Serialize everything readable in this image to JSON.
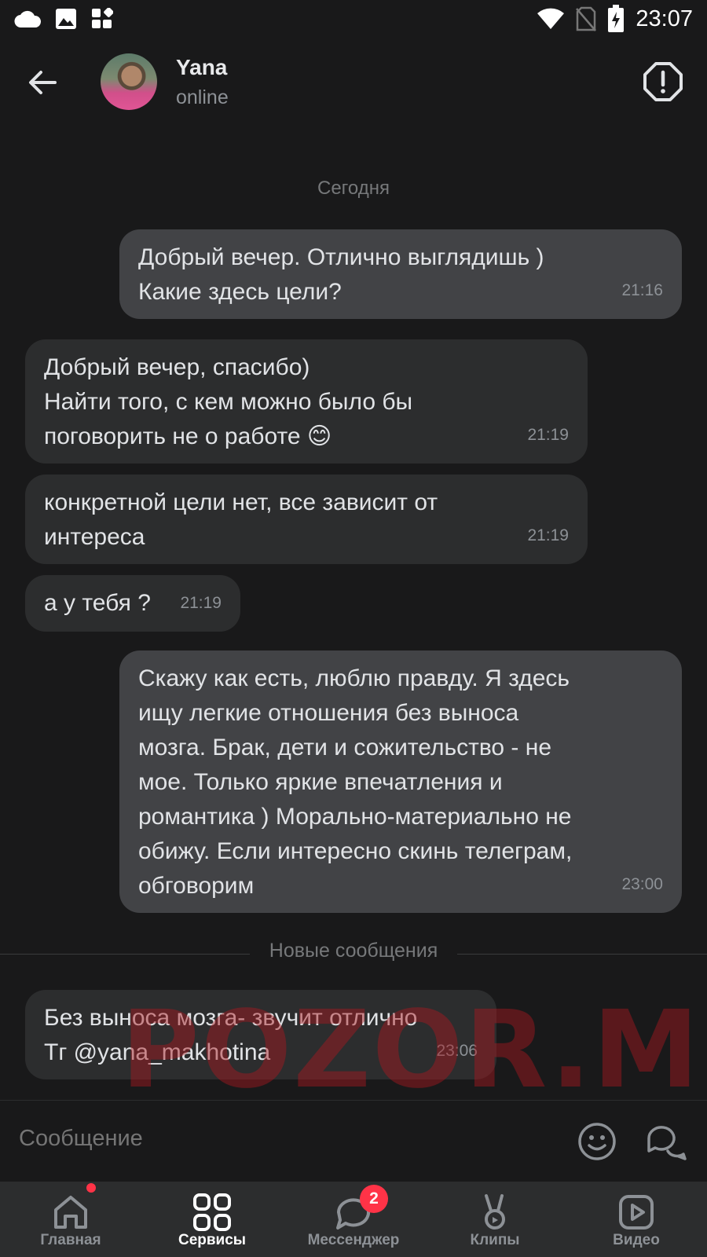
{
  "status_bar": {
    "time": "23:07",
    "left_icons": [
      "cloud-icon",
      "image-icon",
      "widgets-icon"
    ],
    "right_icons": [
      "wifi-icon",
      "no-sim-icon",
      "battery-charging-icon"
    ]
  },
  "header": {
    "contact_name": "Yana",
    "contact_status": "online",
    "back_icon": "arrow-left-icon",
    "report_icon": "alert-octagon-icon"
  },
  "chat": {
    "date_separator": "Сегодня",
    "new_messages_separator": "Новые сообщения",
    "messages": [
      {
        "direction": "out",
        "text": "Добрый вечер. Отлично выглядишь )\nКакие здесь цели?",
        "time": "21:16"
      },
      {
        "direction": "in",
        "text": "Добрый вечер, спасибо)\nНайти того, с кем можно было бы\nпоговорить не о работе 😊",
        "time": "21:19"
      },
      {
        "direction": "in",
        "text": "конкретной цели нет, все зависит от\nинтереса",
        "time": "21:19"
      },
      {
        "direction": "in",
        "text": "а у тебя ?",
        "time": "21:19"
      },
      {
        "direction": "out",
        "text": "Скажу как есть, люблю правду. Я здесь\nищу легкие отношения без выноса\nмозга. Брак, дети и сожительство - не\nмое. Только яркие впечатления и\nромантика ) Морально-материально не\nобижу. Если интересно скинь телеграм,\nобговорим",
        "time": "23:00"
      },
      {
        "direction": "in",
        "text": "Без выноса мозга- звучит отлично\nТг @yana_makhotina",
        "time": "23:06"
      }
    ]
  },
  "watermark": "POZOR.ME",
  "composer": {
    "placeholder": "Сообщение",
    "emoji_icon": "smile-icon",
    "bot_icon": "chat-bubbles-icon"
  },
  "tabbar": {
    "tabs": [
      {
        "label": "Главная",
        "icon": "home-icon",
        "active": false,
        "dot": true
      },
      {
        "label": "Сервисы",
        "icon": "services-icon",
        "active": true
      },
      {
        "label": "Мессенджер",
        "icon": "messenger-icon",
        "active": false,
        "badge": "2"
      },
      {
        "label": "Клипы",
        "icon": "clips-icon",
        "active": false
      },
      {
        "label": "Видео",
        "icon": "video-icon",
        "active": false
      }
    ]
  },
  "colors": {
    "background": "#19191a",
    "outgoing_bubble": "#424346",
    "incoming_bubble": "#2c2d2e",
    "badge": "#ff3347",
    "muted_text": "#8d9196"
  }
}
